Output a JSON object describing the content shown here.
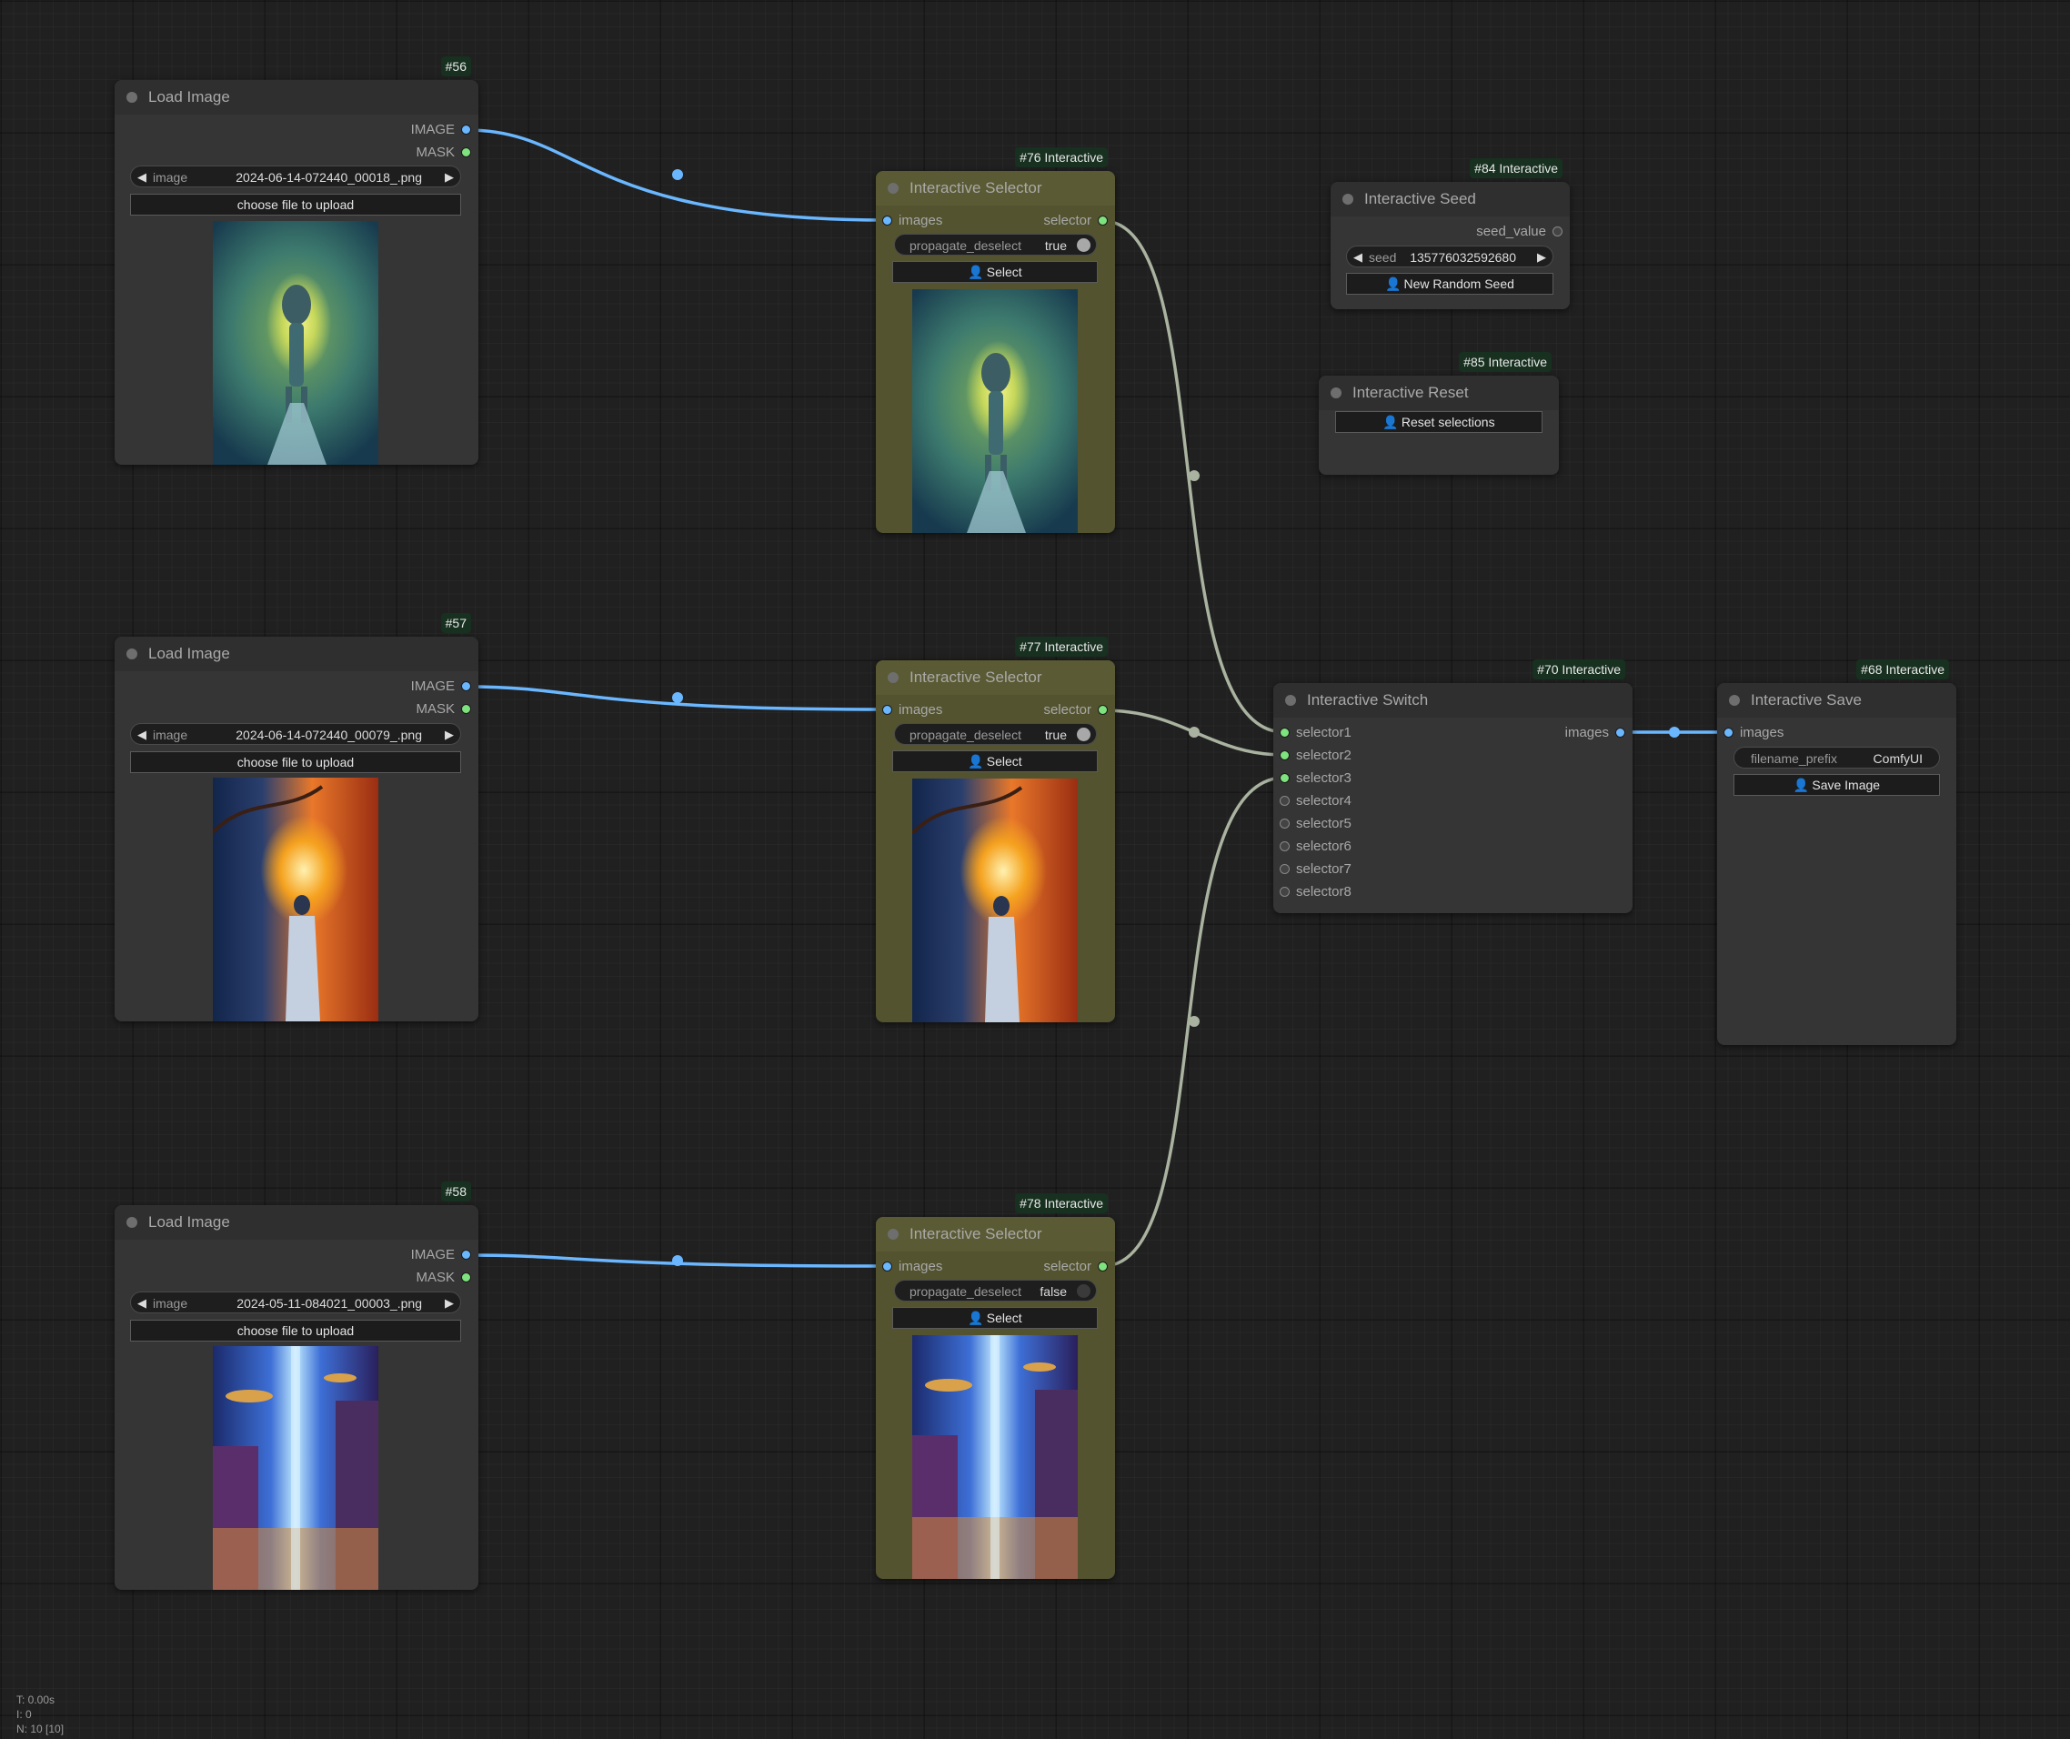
{
  "nodes": {
    "load56": {
      "badge": "#56",
      "title": "Load Image",
      "out1": "IMAGE",
      "out2": "MASK",
      "image_label": "image",
      "image_value": "2024-06-14-072440_00018_.png",
      "upload": "choose file to upload"
    },
    "load57": {
      "badge": "#57",
      "title": "Load Image",
      "out1": "IMAGE",
      "out2": "MASK",
      "image_label": "image",
      "image_value": "2024-06-14-072440_00079_.png",
      "upload": "choose file to upload"
    },
    "load58": {
      "badge": "#58",
      "title": "Load Image",
      "out1": "IMAGE",
      "out2": "MASK",
      "image_label": "image",
      "image_value": "2024-05-11-084021_00003_.png",
      "upload": "choose file to upload"
    },
    "sel76": {
      "badge": "#76 Interactive",
      "title": "Interactive Selector",
      "in": "images",
      "out": "selector",
      "toggle_label": "propagate_deselect",
      "toggle_value": "true",
      "button": "Select"
    },
    "sel77": {
      "badge": "#77 Interactive",
      "title": "Interactive Selector",
      "in": "images",
      "out": "selector",
      "toggle_label": "propagate_deselect",
      "toggle_value": "true",
      "button": "Select"
    },
    "sel78": {
      "badge": "#78 Interactive",
      "title": "Interactive Selector",
      "in": "images",
      "out": "selector",
      "toggle_label": "propagate_deselect",
      "toggle_value": "false",
      "button": "Select"
    },
    "seed84": {
      "badge": "#84 Interactive",
      "title": "Interactive Seed",
      "out": "seed_value",
      "seed_label": "seed",
      "seed_value": "135776032592680",
      "button": "New Random Seed"
    },
    "reset85": {
      "badge": "#85 Interactive",
      "title": "Interactive Reset",
      "button": "Reset selections"
    },
    "switch70": {
      "badge": "#70 Interactive",
      "title": "Interactive Switch",
      "out": "images",
      "inputs": [
        "selector1",
        "selector2",
        "selector3",
        "selector4",
        "selector5",
        "selector6",
        "selector7",
        "selector8"
      ]
    },
    "save68": {
      "badge": "#68 Interactive",
      "title": "Interactive Save",
      "in": "images",
      "prefix_label": "filename_prefix",
      "prefix_value": "ComfyUI",
      "button": "Save Image"
    }
  },
  "stats": {
    "t": "T: 0.00s",
    "i": "I: 0",
    "n": "N: 10 [10]"
  },
  "colors": {
    "image_link": "#6ab7ff",
    "selector_link": "#a9b3a0",
    "olive_node": "#535330",
    "badge_bg": "#17301f"
  },
  "icons": {
    "button_icon": "user-icon"
  }
}
